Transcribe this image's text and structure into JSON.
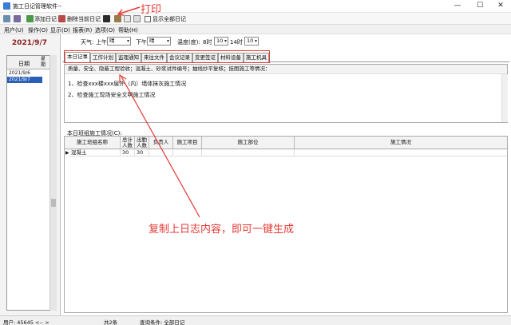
{
  "window": {
    "title": "施工日记管理软件--"
  },
  "toolbar": {
    "add_label": "添加日记",
    "delete_label": "删除当前日记",
    "show_all_label": "显示全部日记"
  },
  "menu": {
    "items": [
      "用户(U)",
      "操作(O)",
      "显示(D)",
      "报表(R)",
      "选项(O)",
      "帮助(H)"
    ]
  },
  "sidebar": {
    "current_date": "2021/9/7",
    "col_date": "日期",
    "col_week": "星期",
    "dates": [
      "2021/9/6",
      "2021/9/7"
    ],
    "selected_index": 1
  },
  "weather": {
    "label": "天气:",
    "am_label": "上午",
    "am_value": "晴",
    "pm_label": "下午",
    "pm_value": "晴",
    "temp_label": "温度(度):",
    "t8_label": "8时",
    "t8_value": "10",
    "t14_label": "14时",
    "t14_value": "10"
  },
  "tabs": [
    "本日记事",
    "工作计划",
    "监理通知",
    "来往文件",
    "会议记录",
    "变更签证",
    "材料设备",
    "施工机具"
  ],
  "active_tab": 0,
  "notes": {
    "quickbar": "质量、安全、隐蔽工程验收；混凝土、砂浆试件编号；抽线抄平复核；挂图施工等情况：",
    "lines": [
      "1、检查xxx楼xxx层外（内）墙体抹灰施工情况",
      "2、检查施工现场安全文明施工情况"
    ]
  },
  "crew": {
    "section_label": "本日班组施工情况(C):",
    "headers": {
      "team": "施工班组名称",
      "planned": "总计人数",
      "present": "出勤人数",
      "lead": "负责人",
      "item": "施工项目",
      "location": "施工部位",
      "status": "施工情况"
    },
    "rows": [
      {
        "team": "混凝土",
        "planned": "30",
        "present": "30",
        "lead": "",
        "item": "",
        "location": "",
        "status": ""
      }
    ]
  },
  "annotations": {
    "print_label": "打印",
    "copy_note": "复制上日志内容，即可一键生成"
  },
  "status": {
    "user": "用户: 45645 <-- >",
    "count": "共2条",
    "filter": "查询条件: 全部日记"
  },
  "colors": {
    "accent_red": "#e53935",
    "date_red": "#8b1a1a",
    "selection_blue": "#2a5fb8"
  }
}
